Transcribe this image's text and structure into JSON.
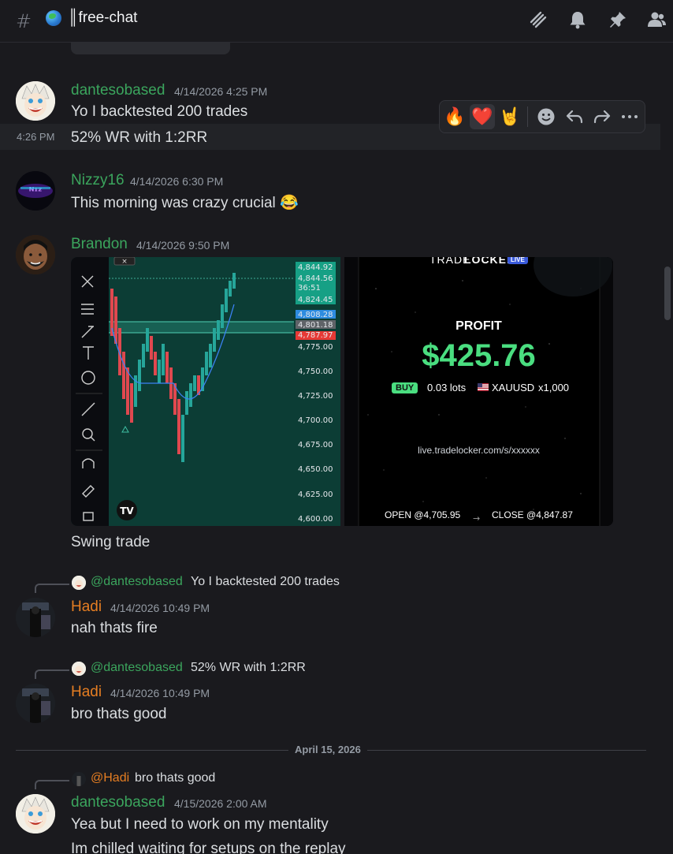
{
  "header": {
    "channel": "║free-chat"
  },
  "messages": [
    {
      "user": "dantesobased",
      "timestamp": "4/14/2026 4:25 PM",
      "lines": [
        "Yo I backtested 200 trades"
      ],
      "followup_time": "4:26 PM",
      "followup": "52% WR with 1:2RR"
    },
    {
      "user": "Nizzy16",
      "timestamp": "4/14/2026 6:30 PM",
      "lines": [
        "This morning was crazy crucial 😂"
      ]
    },
    {
      "user": "Brandon",
      "timestamp": "4/14/2026 9:50 PM",
      "caption": "Swing trade"
    },
    {
      "reply_user": "@dantesobased",
      "reply_text": "Yo I backtested 200 trades",
      "user": "Hadi",
      "timestamp": "4/14/2026 10:49 PM",
      "lines": [
        "nah thats fire"
      ]
    },
    {
      "reply_user": "@dantesobased",
      "reply_text": "52% WR with 1:2RR",
      "user": "Hadi",
      "timestamp": "4/14/2026 10:49 PM",
      "lines": [
        "bro thats good"
      ]
    },
    {
      "reply_user": "@Hadi",
      "reply_text": "bro thats good",
      "user": "dantesobased",
      "timestamp": "4/15/2026 2:00 AM",
      "lines": [
        "Yea but I need to work on my mentality",
        "Im chilled waiting for setups on the replay"
      ]
    }
  ],
  "date_divider": "April 15, 2026",
  "reactions": [
    "🔥",
    "❤️",
    "🤘"
  ],
  "chart_image": {
    "price_labels": [
      "4,844.92",
      "4,844.56",
      "36:51",
      "4,824.45",
      "4,808.28",
      "4,801.18",
      "4,787.97",
      "4,775.00",
      "4,750.00",
      "4,725.00",
      "4,700.00",
      "4,675.00",
      "4,650.00",
      "4,625.00",
      "4,600.00"
    ],
    "logo": "TV"
  },
  "trade_card": {
    "brand_a": "TRADE",
    "brand_b": "LOCKER",
    "live_badge": "LIVE",
    "profit_label": "PROFIT",
    "profit_value": "$425.76",
    "side": "BUY",
    "lots": "0.03 lots",
    "symbol": "XAUUSD",
    "leverage": "x1,000",
    "link": "live.tradelocker.com/s/xxxxxx",
    "open": "OPEN @4,705.95",
    "close": "CLOSE @4,847.87"
  },
  "colors": {
    "green_user": "#3ba55d",
    "orange_user": "#e67e22",
    "profit_green": "#4ade80"
  }
}
